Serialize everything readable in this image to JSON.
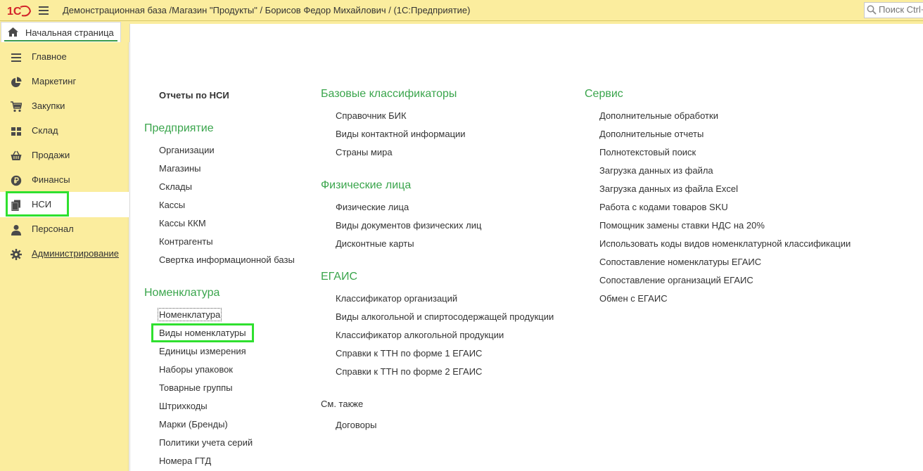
{
  "titlebar": {
    "logo_text": "1С",
    "title": "Демонстрационная база /Магазин \"Продукты\" / Борисов Федор Михайлович /  (1С:Предприятие)",
    "search_placeholder": "Поиск Ctrl+"
  },
  "tabs": {
    "home_label": "Начальная страница"
  },
  "sidebar": {
    "items": [
      {
        "label": "Главное",
        "icon": "menu-lines-icon"
      },
      {
        "label": "Маркетинг",
        "icon": "pie-chart-icon"
      },
      {
        "label": "Закупки",
        "icon": "cart-icon"
      },
      {
        "label": "Склад",
        "icon": "warehouse-grid-icon"
      },
      {
        "label": "Продажи",
        "icon": "basket-icon"
      },
      {
        "label": "Финансы",
        "icon": "ruble-coin-icon"
      },
      {
        "label": "НСИ",
        "icon": "documents-icon"
      },
      {
        "label": "Персонал",
        "icon": "person-icon"
      },
      {
        "label": "Администрирование",
        "icon": "gear-icon"
      }
    ],
    "active": "НСИ"
  },
  "main": {
    "col1": {
      "reports_title": "Отчеты по НСИ",
      "enterprise_title": "Предприятие",
      "enterprise_links": [
        "Организации",
        "Магазины",
        "Склады",
        "Кассы",
        "Кассы ККМ",
        "Контрагенты",
        "Свертка информационной базы"
      ],
      "nomenclature_title": "Номенклатура",
      "nomenclature_links": [
        "Номенклатура",
        "Виды номенклатуры",
        "Единицы измерения",
        "Наборы упаковок",
        "Товарные группы",
        "Штрихкоды",
        "Марки (Бренды)",
        "Политики учета серий",
        "Номера ГТД"
      ]
    },
    "col2": {
      "base_title": "Базовые классификаторы",
      "base_links": [
        "Справочник БИК",
        "Виды контактной информации",
        "Страны мира"
      ],
      "persons_title": "Физические лица",
      "persons_links": [
        "Физические лица",
        "Виды документов физических лиц",
        "Дисконтные карты"
      ],
      "egais_title": "ЕГАИС",
      "egais_links": [
        "Классификатор организаций",
        "Виды алкогольной и спиртосодержащей продукции",
        "Классификатор алкогольной продукции",
        "Справки к ТТН по форме 1 ЕГАИС",
        "Справки к ТТН по форме 2 ЕГАИС"
      ],
      "see_also_title": "См. также",
      "see_also_links": [
        "Договоры"
      ]
    },
    "col3": {
      "service_title": "Сервис",
      "service_links": [
        "Дополнительные обработки",
        "Дополнительные отчеты",
        "Полнотекстовый поиск",
        "Загрузка данных из файла",
        "Загрузка данных из файла Excel",
        "Работа с кодами товаров SKU",
        "Помощник замены ставки НДС на 20%",
        "Использовать коды видов номенклатурной классификации",
        "Сопоставление номенклатуры ЕГАИС",
        "Сопоставление организаций ЕГАИС",
        "Обмен с ЕГАИС"
      ]
    }
  },
  "colors": {
    "accent_green": "#3aa54c",
    "panel_yellow": "#fbed9e",
    "highlight": "#2fe02f"
  }
}
